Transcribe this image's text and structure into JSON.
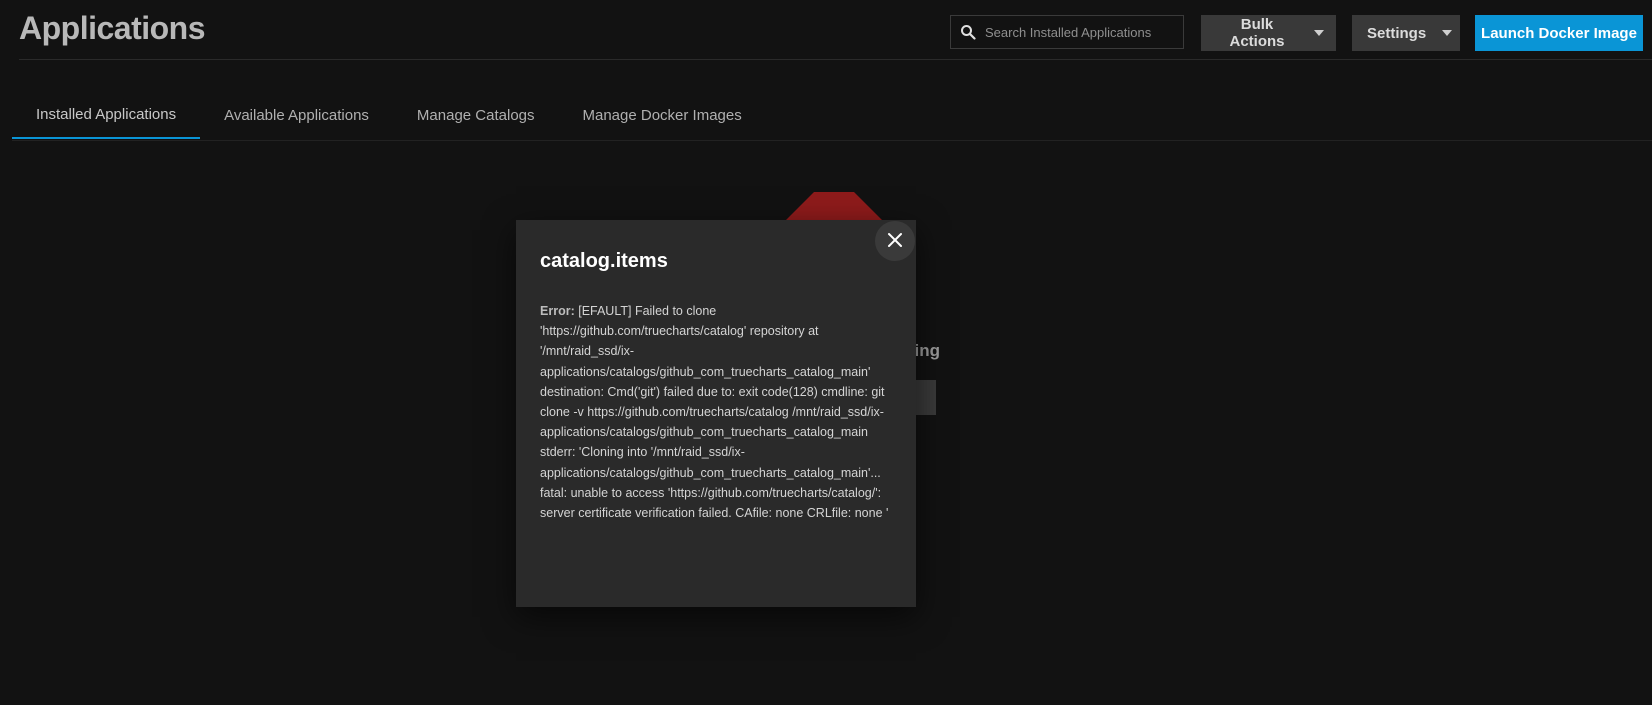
{
  "header": {
    "title": "Applications",
    "search": {
      "placeholder": "Search Installed Applications",
      "value": ""
    },
    "bulk_actions_label": "Bulk Actions",
    "settings_label": "Settings",
    "launch_label": "Launch Docker Image"
  },
  "tabs": [
    {
      "label": "Installed Applications",
      "active": true
    },
    {
      "label": "Available Applications",
      "active": false
    },
    {
      "label": "Manage Catalogs",
      "active": false
    },
    {
      "label": "Manage Docker Images",
      "active": false
    }
  ],
  "background": {
    "empty_text_fragment": "ing"
  },
  "dialog": {
    "title": "catalog.items",
    "error_label": "Error:",
    "error_message": "[EFAULT] Failed to clone 'https://github.com/truecharts/catalog' repository at '/mnt/raid_ssd/ix-applications/catalogs/github_com_truecharts_catalog_main' destination: Cmd('git') failed due to: exit code(128) cmdline: git clone -v https://github.com/truecharts/catalog /mnt/raid_ssd/ix-applications/catalogs/github_com_truecharts_catalog_main stderr: 'Cloning into '/mnt/raid_ssd/ix-applications/catalogs/github_com_truecharts_catalog_main'... fatal: unable to access 'https://github.com/truecharts/catalog/': server certificate verification failed. CAfile: none CRLfile: none '"
  },
  "colors": {
    "accent": "#0a95d6",
    "background": "#121212",
    "dialog": "#2a2a2a",
    "error_icon": "#8e1b1b"
  },
  "icons": {
    "search": "search-icon",
    "caret": "chevron-down-icon",
    "close": "close-icon",
    "error": "stop-octagon-icon"
  }
}
